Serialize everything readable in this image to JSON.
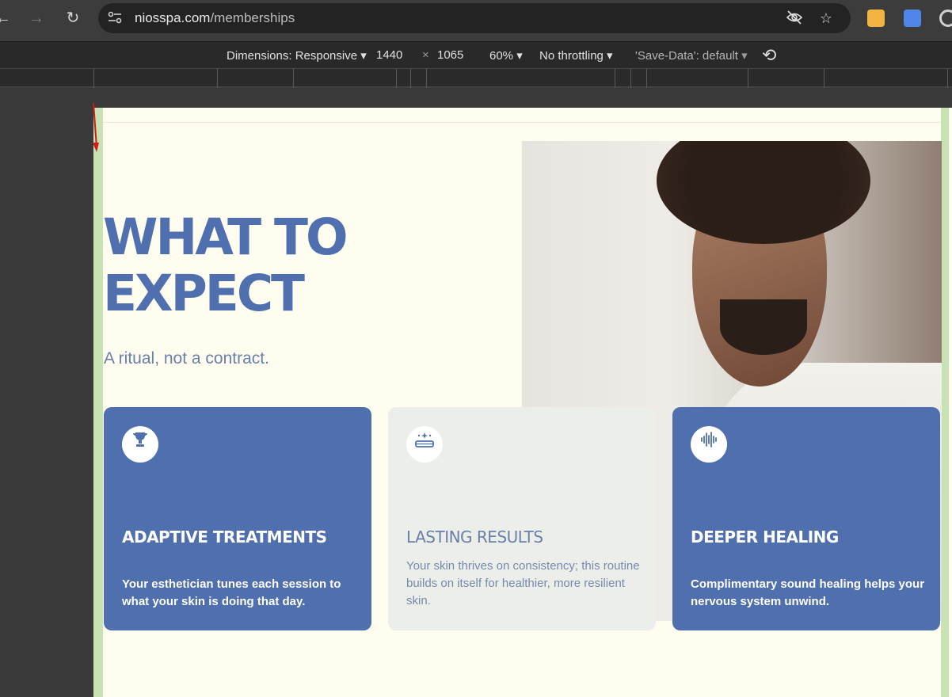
{
  "browser": {
    "url_host": "niosspa.com",
    "url_path": "/memberships"
  },
  "devtools": {
    "dimensions_label": "Dimensions: Responsive",
    "width": "1440",
    "times": "×",
    "height": "1065",
    "zoom": "60%",
    "throttling": "No throttling",
    "save_data": "'Save-Data': default"
  },
  "hero": {
    "title_line1": "WHAT TO",
    "title_line2": "EXPECT",
    "subtitle": "A ritual, not a contract."
  },
  "cards": [
    {
      "icon": "trophy-icon",
      "title": "ADAPTIVE TREATMENTS",
      "text": "Your esthetician tunes each session to what your skin is doing that day."
    },
    {
      "icon": "sparkle-tray-icon",
      "title": "LASTING RESULTS",
      "text": "Your skin thrives on consistency; this routine builds on itself for healthier, more resilient skin."
    },
    {
      "icon": "sound-wave-icon",
      "title": "DEEPER HEALING",
      "text": "Complimentary sound healing helps your nervous system unwind."
    }
  ],
  "colors": {
    "brand_blue": "#4f6fae",
    "page_bg": "#fffdf0",
    "card_grey": "#eceee9"
  }
}
